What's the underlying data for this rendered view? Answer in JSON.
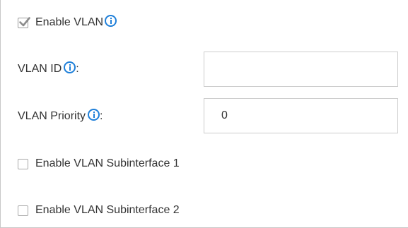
{
  "vlan": {
    "enable_label": "Enable VLAN",
    "enable_checked": true,
    "id_label": "VLAN ID",
    "id_suffix": ":",
    "id_value": "",
    "priority_label": "VLAN Priority",
    "priority_suffix": ":",
    "priority_value": "0",
    "subinterface_1_label": "Enable VLAN Subinterface 1",
    "subinterface_1_checked": false,
    "subinterface_2_label": "Enable VLAN Subinterface 2",
    "subinterface_2_checked": false
  },
  "icons": {
    "info": "info-circle-icon",
    "check": "check-icon"
  },
  "colors": {
    "info_blue": "#1e7fd9",
    "checkmark": "#8c8c8c",
    "border": "#cccccc"
  }
}
